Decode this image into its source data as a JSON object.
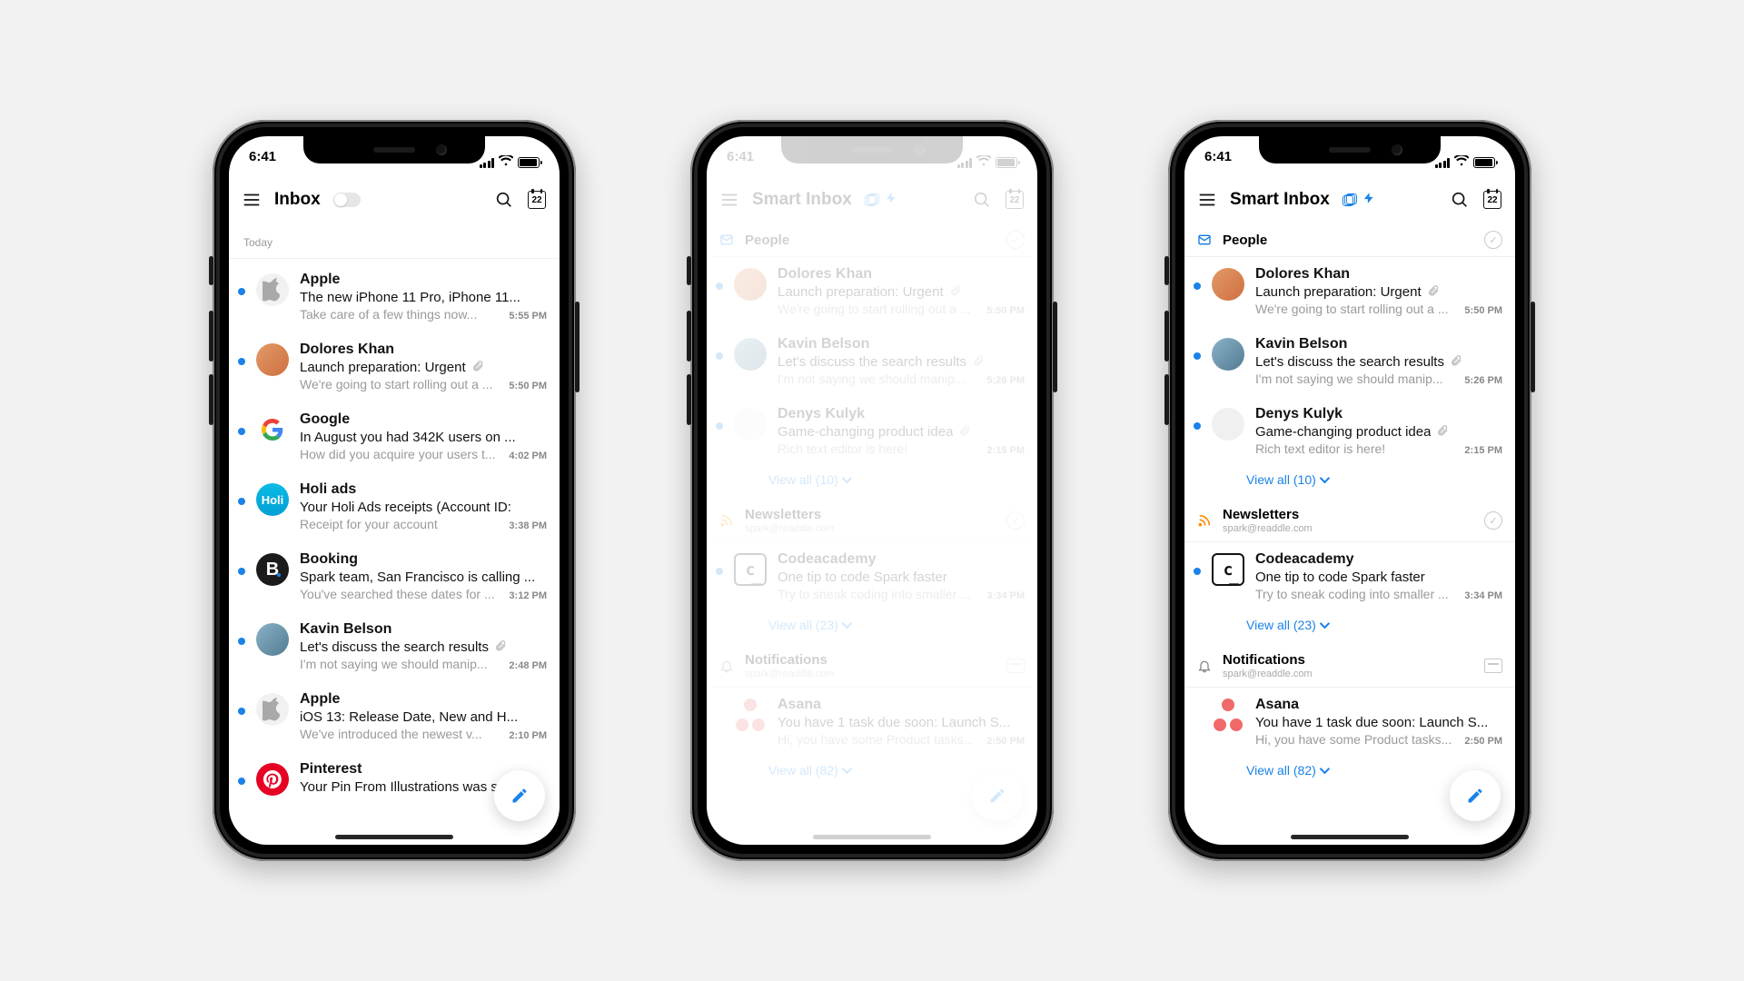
{
  "status": {
    "time": "6:41",
    "calendar_day": "22"
  },
  "phone1": {
    "nav_title": "Inbox",
    "day_label": "Today",
    "compose": "Compose",
    "rows": [
      {
        "sender": "Apple",
        "subject": "The new iPhone 11 Pro, iPhone 11...",
        "preview": "Take care of a few things now...",
        "time": "5:55 PM",
        "avatar": "logo-apple",
        "unread": true,
        "attachment": false
      },
      {
        "sender": "Dolores Khan",
        "subject": "Launch preparation: Urgent",
        "preview": "We're going to start rolling out a ...",
        "time": "5:50 PM",
        "avatar": "photo1",
        "unread": true,
        "attachment": true
      },
      {
        "sender": "Google",
        "subject": "In August you had 342K users on ...",
        "preview": "How did you acquire your users t...",
        "time": "4:02 PM",
        "avatar": "logo-google",
        "unread": true,
        "attachment": false
      },
      {
        "sender": "Holi ads",
        "subject": "Your Holi Ads receipts (Account ID:",
        "preview": "Receipt for your account",
        "time": "3:38 PM",
        "avatar": "logo-holi",
        "unread": true,
        "attachment": false
      },
      {
        "sender": "Booking",
        "subject": "Spark team, San Francisco is calling ...",
        "preview": "You've searched these dates for ...",
        "time": "3:12 PM",
        "avatar": "logo-booking",
        "unread": true,
        "attachment": false
      },
      {
        "sender": "Kavin Belson",
        "subject": "Let's discuss the search results",
        "preview": "I'm not saying we should manip...",
        "time": "2:48 PM",
        "avatar": "photo2",
        "unread": true,
        "attachment": true
      },
      {
        "sender": "Apple",
        "subject": "iOS 13: Release Date, New and H...",
        "preview": "We've introduced the newest v...",
        "time": "2:10 PM",
        "avatar": "logo-apple",
        "unread": true,
        "attachment": false
      },
      {
        "sender": "Pinterest",
        "subject": "Your Pin From Illustrations was sav...",
        "preview": "",
        "time": "",
        "avatar": "logo-pinterest",
        "unread": true,
        "attachment": false
      }
    ]
  },
  "smart": {
    "nav_title": "Smart Inbox",
    "sections": {
      "people": {
        "title": "People"
      },
      "newsletters": {
        "title": "Newsletters",
        "sub": "spark@readdle.com"
      },
      "notifications": {
        "title": "Notifications",
        "sub": "spark@readdle.com"
      }
    },
    "people_rows": [
      {
        "sender": "Dolores Khan",
        "subject": "Launch preparation: Urgent",
        "preview": "We're going to start rolling out a ...",
        "time": "5:50 PM",
        "avatar": "photo1",
        "unread": true,
        "attachment": true
      },
      {
        "sender": "Kavin Belson",
        "subject": "Let's discuss the search results",
        "preview": "I'm not saying we should manip...",
        "time": "5:26 PM",
        "avatar": "photo2",
        "unread": true,
        "attachment": true
      },
      {
        "sender": "Denys Kulyk",
        "subject": "Game-changing product idea",
        "preview": "Rich text editor is here!",
        "time": "2:15 PM",
        "avatar": "photo3",
        "unread": true,
        "attachment": true
      }
    ],
    "people_view_all": "View all (10)",
    "news_rows": [
      {
        "sender": "Codeacademy",
        "subject": "One tip to code Spark faster",
        "preview": "Try to sneak coding into smaller ...",
        "time": "3:34 PM",
        "avatar": "logo-code",
        "unread": true,
        "attachment": false
      }
    ],
    "news_view_all": "View all (23)",
    "notif_rows": [
      {
        "sender": "Asana",
        "subject": "You have 1 task due soon: Launch S...",
        "preview": "Hi, you have some Product tasks...",
        "time": "2:50 PM",
        "avatar": "logo-asana",
        "unread": false,
        "attachment": false
      }
    ],
    "notif_view_all": "View all (82)"
  }
}
